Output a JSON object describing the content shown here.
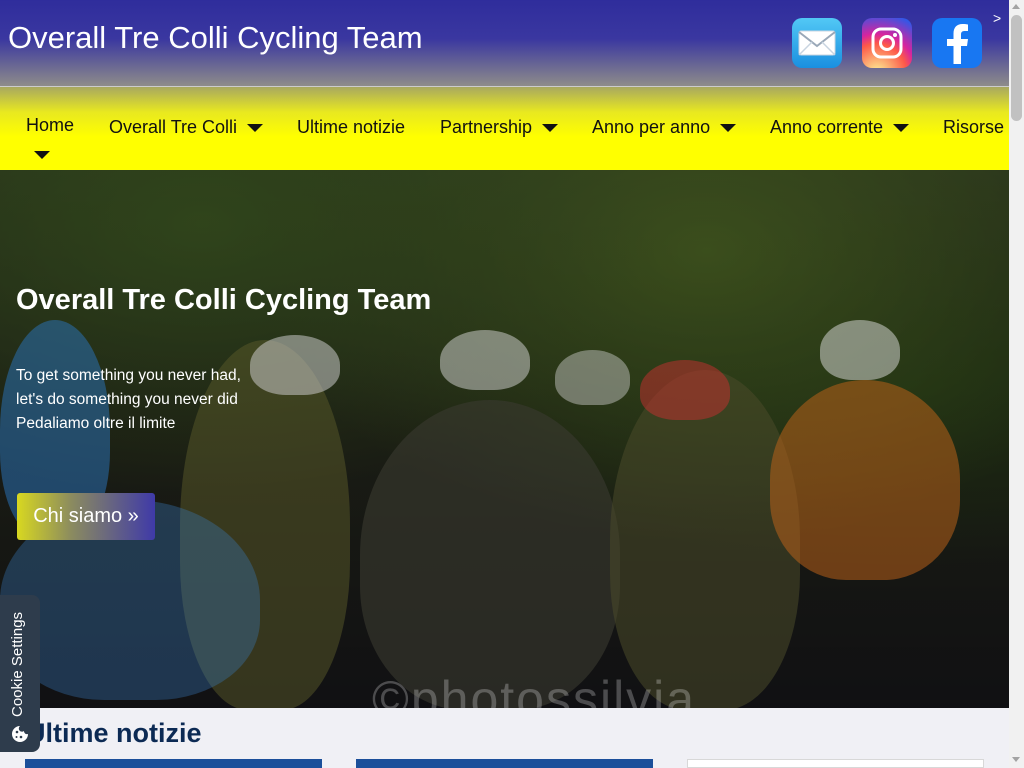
{
  "header": {
    "site_title": "Overall Tre Colli Cycling Team",
    "social": [
      {
        "icon": "mail-icon"
      },
      {
        "icon": "instagram-icon"
      },
      {
        "icon": "facebook-icon"
      }
    ],
    "overflow_marker": ">"
  },
  "nav": {
    "items": [
      {
        "label": "Home",
        "has_dropdown": true
      },
      {
        "label": "Overall Tre Colli",
        "has_dropdown": true
      },
      {
        "label": "Ultime notizie",
        "has_dropdown": false
      },
      {
        "label": "Partnership",
        "has_dropdown": true
      },
      {
        "label": "Anno per anno",
        "has_dropdown": true
      },
      {
        "label": "Anno corrente",
        "has_dropdown": true
      },
      {
        "label": "Risorse",
        "has_dropdown": false
      }
    ]
  },
  "hero": {
    "title": "Overall Tre Colli Cycling Team",
    "lines": [
      "To get something you never had,",
      "let's do something you never did",
      "Pedaliamo oltre il limite"
    ],
    "cta_label": "Chi siamo »",
    "watermark": "©photossilvia"
  },
  "cookie": {
    "label": "Cookie Settings"
  },
  "news": {
    "heading": "Ultime notizie"
  },
  "colors": {
    "header_blue": "#2f2d9c",
    "nav_yellow": "#ffff00",
    "heading_navy": "#0c2a54"
  }
}
